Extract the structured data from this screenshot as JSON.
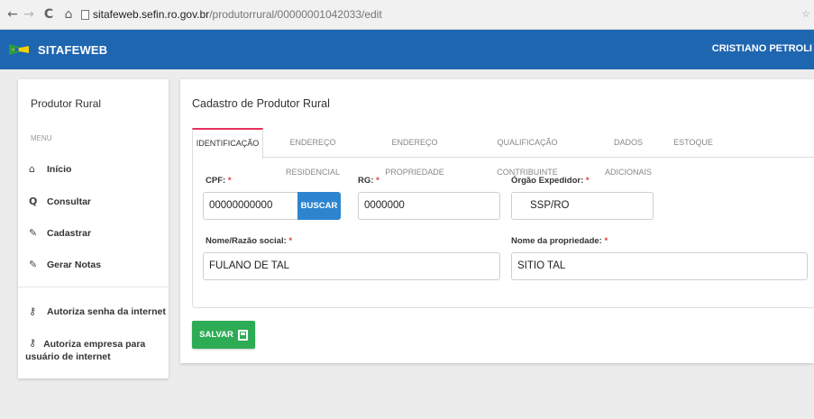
{
  "browser": {
    "url_host": "sitafeweb.sefin.ro.gov.br",
    "url_path": "/produtorrural/00000001042033/edit"
  },
  "header": {
    "brand": "SITAFEWEB",
    "user": "CRISTIANO PETROLI",
    "colors": {
      "appbar": "#1f66b1"
    }
  },
  "sidebar": {
    "title": "Produtor Rural",
    "menu_heading": "MENU",
    "items": [
      {
        "icon": "home-icon",
        "label": "Início"
      },
      {
        "icon": "search-icon",
        "label": "Consultar"
      },
      {
        "icon": "edit-icon",
        "label": "Cadastrar"
      },
      {
        "icon": "edit-icon",
        "label": "Gerar Notas"
      }
    ],
    "secondary_items": [
      {
        "icon": "key-icon",
        "label": "Autoriza senha da internet"
      },
      {
        "icon": "key-icon",
        "label": "Autoriza empresa para usuário de internet"
      }
    ]
  },
  "main": {
    "title": "Cadastro de Produtor Rural",
    "tabs": [
      {
        "label": "IDENTIFICAÇÃO",
        "active": true
      },
      {
        "label": "ENDEREÇO RESIDENCIAL",
        "active": false
      },
      {
        "label": "ENDEREÇO PROPRIEDADE",
        "active": false
      },
      {
        "label": "QUALIFICAÇÃO CONTRIBUINTE",
        "active": false
      },
      {
        "label": "DADOS ADICIONAIS",
        "active": false
      },
      {
        "label": "ESTOQUE",
        "active": false
      }
    ],
    "form": {
      "cpf": {
        "label": "CPF:",
        "required_mark": "*",
        "value": "00000000000"
      },
      "buscar_label": "BUSCAR",
      "rg": {
        "label": "RG:",
        "required_mark": "*",
        "value": "0000000"
      },
      "orgao": {
        "label": "Órgão Expedidor:",
        "required_mark": "*",
        "value": "SSP/RO"
      },
      "nome": {
        "label": "Nome/Razão social:",
        "required_mark": "*",
        "value": "FULANO DE TAL"
      },
      "propriedade": {
        "label": "Nome da propriedade:",
        "required_mark": "*",
        "value": "SITIO TAL"
      }
    },
    "save_label": "SALVAR",
    "colors": {
      "active_tab": "#e8305e",
      "buscar": "#2d85d0",
      "salvar": "#2eac55",
      "required": "#e03a3a"
    }
  }
}
